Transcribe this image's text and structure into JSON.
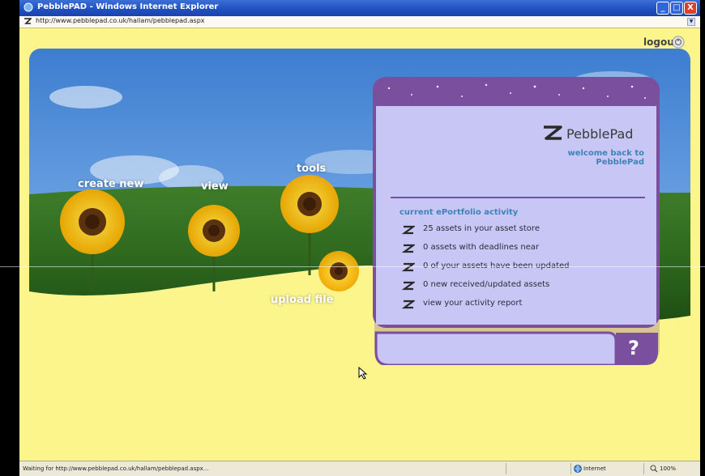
{
  "window": {
    "title": "PebblePAD - Windows Internet Explorer",
    "address": "http://www.pebblepad.co.uk/hallam/pebblepad.aspx",
    "buttons": {
      "minimize": "_",
      "maximize": "□",
      "close": "X"
    }
  },
  "header": {
    "logout_label": "logout"
  },
  "scene": {
    "labels": {
      "create_new": "create new",
      "view": "view",
      "tools": "tools",
      "upload_file": "upload file"
    }
  },
  "panel": {
    "brand": "PebblePad",
    "welcome": "welcome back to PebblePad",
    "activity_title": "current ePortfolio activity",
    "items": [
      "25 assets in your asset store",
      "0 assets with deadlines near",
      "0 of your assets have been updated",
      "0 new received/updated assets",
      "view your activity report"
    ],
    "help_label": "?"
  },
  "status": {
    "message": "Waiting for http://www.pebblepad.co.uk/hallam/pebblepad.aspx...",
    "zone": "Internet",
    "zoom": "100%"
  },
  "colors": {
    "background_yellow": "#fbf58c",
    "panel_purple": "#7a4f9e",
    "panel_fill": "#c8c6f4",
    "link_blue": "#3d84b8"
  }
}
